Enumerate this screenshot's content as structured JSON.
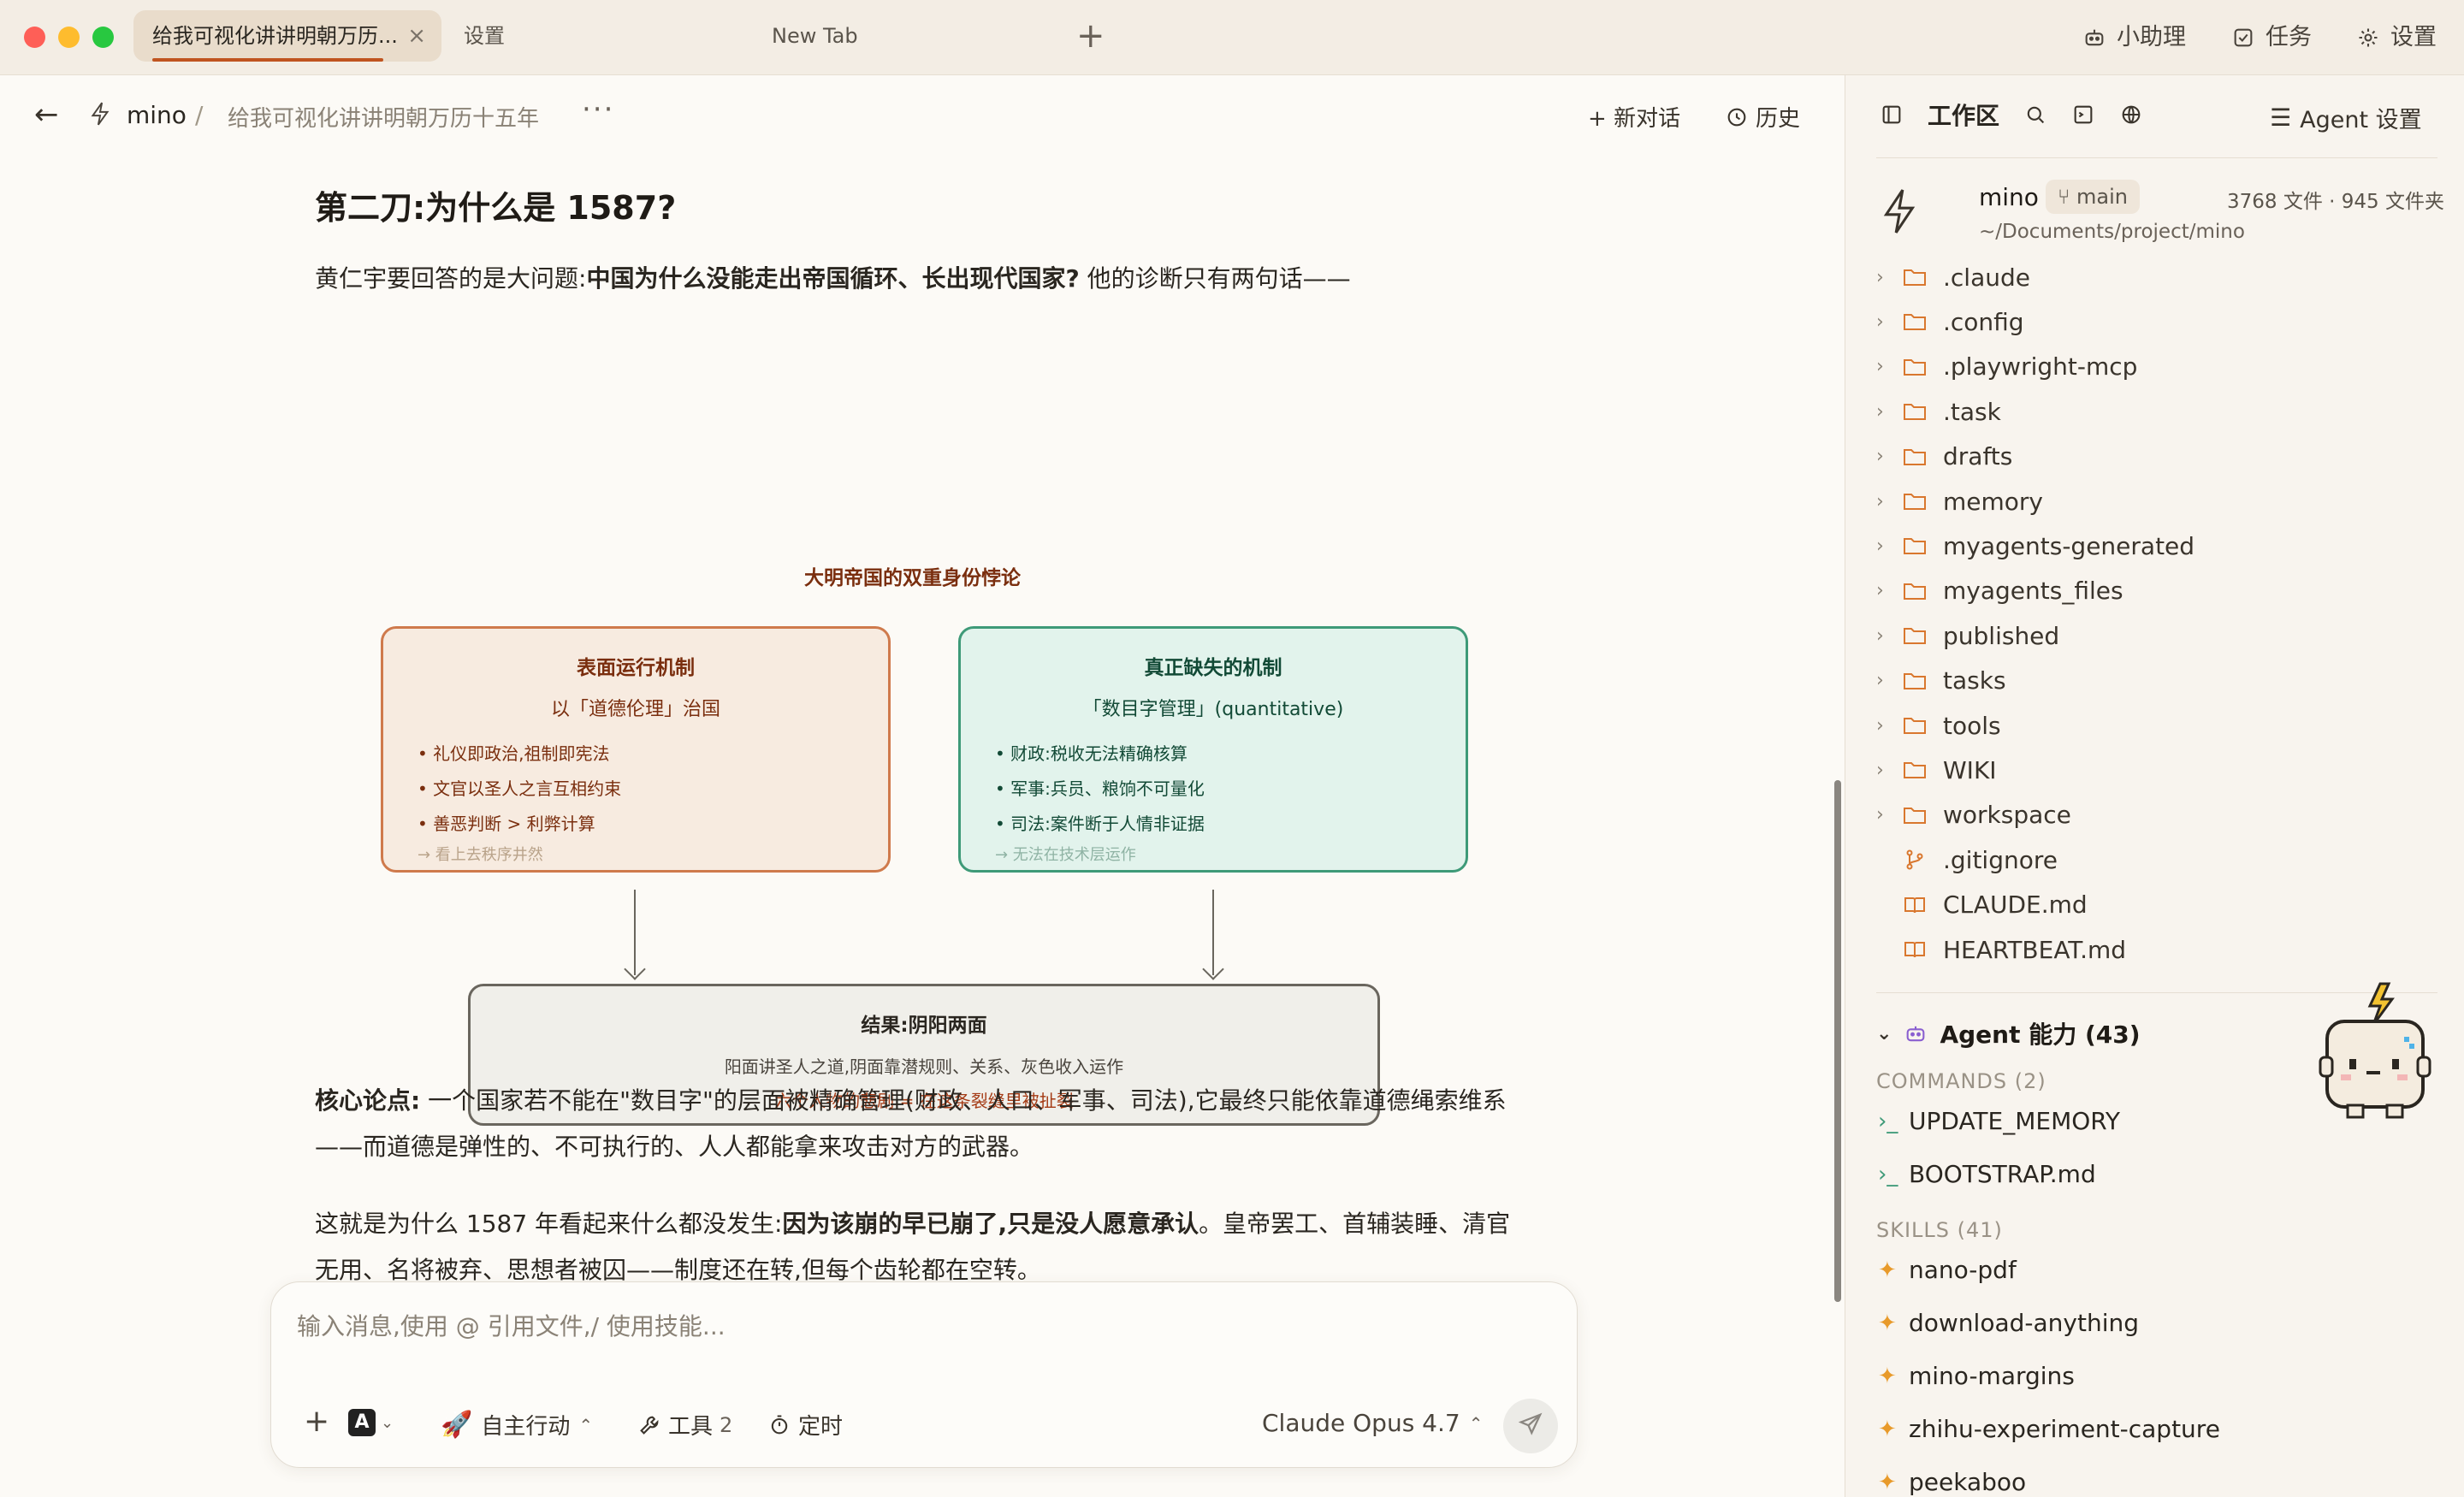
{
  "titlebar": {
    "tabs": [
      {
        "label": "给我可视化讲讲明朝万历...",
        "active": true
      },
      {
        "label": "设置"
      },
      {
        "label": "New Tab"
      }
    ],
    "assistant_label": "小助理",
    "tasks_label": "任务",
    "settings_label": "设置"
  },
  "header": {
    "project": "mino",
    "conversation_title": "给我可视化讲讲明朝万历十五年",
    "more": "···",
    "new_chat": "新对话",
    "history": "历史"
  },
  "content": {
    "heading": "第二刀:为什么是 1587?",
    "intro_plain1": "黄仁宇要回答的是大问题:",
    "intro_bold": "中国为什么没能走出帝国循环、长出现代国家?",
    "intro_plain2": " 他的诊断只有两句话——",
    "diagram": {
      "title": "大明帝国的双重身份悖论",
      "left": {
        "title": "表面运行机制",
        "subtitle": "以「道德伦理」治国",
        "items": [
          "• 礼仪即政治,祖制即宪法",
          "• 文官以圣人之言互相约束",
          "• 善恶判断 > 利弊计算"
        ],
        "note": "→ 看上去秩序井然"
      },
      "right": {
        "title": "真正缺失的机制",
        "subtitle": "「数目字管理」(quantitative)",
        "items": [
          "• 财政:税收无法精确核算",
          "• 军事:兵员、粮饷不可量化",
          "• 司法:案件断于人情非证据"
        ],
        "note": "→ 无法在技术层运作"
      },
      "bottom": {
        "title": "结果:阴阳两面",
        "line1": "阳面讲圣人之道,阴面靠潜规则、关系、灰色收入运作",
        "line2": "六个人物的悲剧 = 在这条裂缝里被扯裂"
      }
    },
    "para1_bold": "核心论点:",
    "para1_text": " 一个国家若不能在\"数目字\"的层面被精确管理(财政、人口、军事、司法),它最终只能依靠道德绳索维系——而道德是弹性的、不可执行的、人人都能拿来攻击对方的武器。",
    "para2_plain": "这就是为什么 1587 年看起来什么都没发生:",
    "para2_bold": "因为该崩的早已崩了,只是没人愿意承认",
    "para2_tail": "。皇帝罢工、首辅装睡、清官无用、名将被弃、思想者被囚——制度还在转,但每个齿轮都在空转。"
  },
  "composer": {
    "placeholder": "输入消息,使用 @ 引用文件,/ 使用技能...",
    "mode_label": "自主行动",
    "tools_label": "工具",
    "tools_count": "2",
    "timer_label": "定时",
    "model_name": "Claude Opus 4.7"
  },
  "workspace": {
    "title": "工作区",
    "agent_settings": "Agent 设置",
    "project_name": "mino",
    "branch": "main",
    "stats": "3768 文件 · 945 文件夹",
    "path": "~/Documents/project/mino",
    "tree": [
      {
        "name": ".claude",
        "type": "folder"
      },
      {
        "name": ".config",
        "type": "folder"
      },
      {
        "name": ".playwright-mcp",
        "type": "folder"
      },
      {
        "name": ".task",
        "type": "folder"
      },
      {
        "name": "drafts",
        "type": "folder"
      },
      {
        "name": "memory",
        "type": "folder"
      },
      {
        "name": "myagents-generated",
        "type": "folder"
      },
      {
        "name": "myagents_files",
        "type": "folder"
      },
      {
        "name": "published",
        "type": "folder"
      },
      {
        "name": "tasks",
        "type": "folder"
      },
      {
        "name": "tools",
        "type": "folder"
      },
      {
        "name": "WIKI",
        "type": "folder"
      },
      {
        "name": "workspace",
        "type": "folder"
      },
      {
        "name": ".gitignore",
        "type": "git"
      },
      {
        "name": "CLAUDE.md",
        "type": "book"
      },
      {
        "name": "HEARTBEAT.md",
        "type": "book"
      }
    ],
    "agent_caps_title": "Agent 能力 (43)",
    "commands_label": "COMMANDS (2)",
    "commands": [
      "UPDATE_MEMORY",
      "BOOTSTRAP.md"
    ],
    "skills_label": "SKILLS (41)",
    "skills": [
      "nano-pdf",
      "download-anything",
      "mino-margins",
      "zhihu-experiment-capture",
      "peekaboo"
    ]
  },
  "colors": {
    "accent": "#c0541f",
    "left_box_fill": "#f7ebe0",
    "left_box_border": "#cf7a4c",
    "right_box_fill": "#e2f3ec",
    "right_box_border": "#3e9a78",
    "folder_icon": "#d9772e"
  }
}
